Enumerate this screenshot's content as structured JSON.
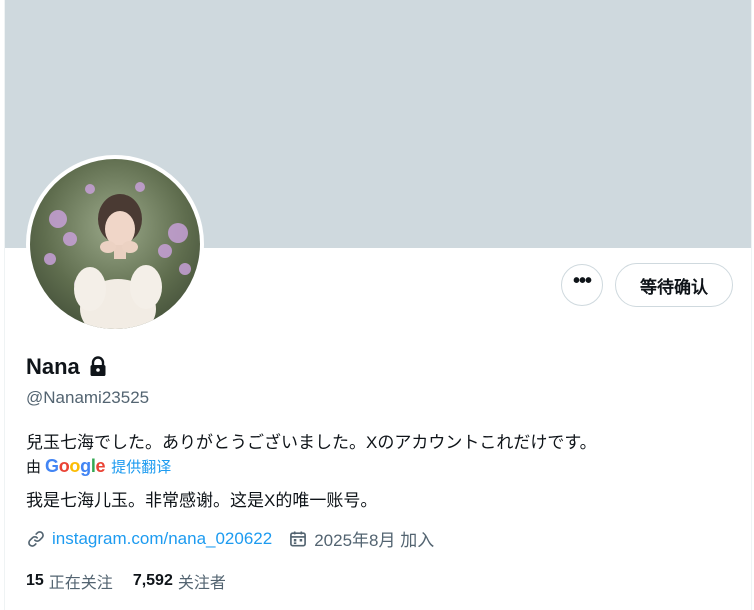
{
  "profile": {
    "name": "Nana",
    "handle": "@Nanami23525",
    "bio": "兒玉七海でした。ありがとうございました。Xのアカウントこれだけです。",
    "translate": {
      "by": "由",
      "google": [
        "G",
        "o",
        "o",
        "g",
        "l",
        "e"
      ],
      "link": "提供翻译"
    },
    "bio_translated": "我是七海儿玉。非常感谢。这是X的唯一账号。",
    "website": "instagram.com/nana_020622",
    "joined": "2025年8月 加入",
    "following_count": "15",
    "following_label": "正在关注",
    "followers_count": "7,592",
    "followers_label": "关注者"
  },
  "actions": {
    "more_label": "•••",
    "follow_label": "等待确认"
  },
  "icons": {
    "lock": "lock-icon",
    "link": "link-icon",
    "calendar": "calendar-icon",
    "more": "more-icon"
  },
  "colors": {
    "banner": "#cfd9de",
    "accent": "#1d9bf0",
    "muted": "#536471",
    "text": "#0f1419"
  }
}
